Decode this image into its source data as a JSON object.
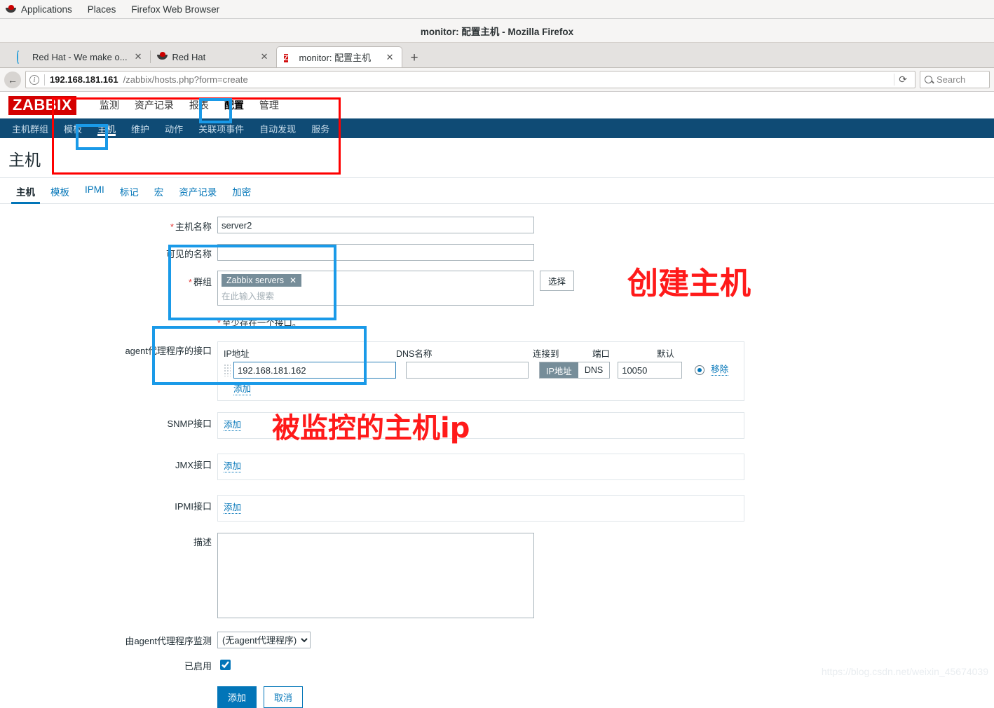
{
  "desktop": {
    "menus": [
      "Applications",
      "Places",
      "Firefox Web Browser"
    ],
    "logo_icon": "redhat-icon"
  },
  "browser": {
    "window_title": "monitor: 配置主机 - Mozilla Firefox",
    "tabs": [
      {
        "title": "Red Hat - We make o...",
        "icon": "ring-icon",
        "active": false,
        "close": "✕"
      },
      {
        "title": "Red Hat",
        "icon": "redhat-icon",
        "active": false,
        "close": "✕"
      },
      {
        "title": "monitor: 配置主机",
        "icon": "zabbix-icon",
        "active": true,
        "close": "✕"
      }
    ],
    "new_tab_label": "+",
    "back_icon": "back-arrow-icon",
    "url_host": "192.168.181.161",
    "url_path": "/zabbix/hosts.php?form=create",
    "reload_icon": "reload-icon",
    "search_placeholder": "Search",
    "search_icon": "search-icon"
  },
  "zabbix": {
    "logo": "ZABBIX",
    "main_menu": [
      {
        "label": "监测",
        "selected": false
      },
      {
        "label": "资产记录",
        "selected": false
      },
      {
        "label": "报表",
        "selected": false
      },
      {
        "label": "配置",
        "selected": true
      },
      {
        "label": "管理",
        "selected": false
      }
    ],
    "sub_menu": [
      {
        "label": "主机群组",
        "selected": false
      },
      {
        "label": "模板",
        "selected": false
      },
      {
        "label": "主机",
        "selected": true
      },
      {
        "label": "维护",
        "selected": false
      },
      {
        "label": "动作",
        "selected": false
      },
      {
        "label": "关联项事件",
        "selected": false
      },
      {
        "label": "自动发现",
        "selected": false
      },
      {
        "label": "服务",
        "selected": false
      }
    ],
    "page_title": "主机",
    "form_tabs": [
      {
        "label": "主机",
        "selected": true
      },
      {
        "label": "模板",
        "selected": false
      },
      {
        "label": "IPMI",
        "selected": false
      },
      {
        "label": "标记",
        "selected": false
      },
      {
        "label": "宏",
        "selected": false
      },
      {
        "label": "资产记录",
        "selected": false
      },
      {
        "label": "加密",
        "selected": false
      }
    ],
    "form": {
      "hostname_label": "主机名称",
      "hostname_value": "server2",
      "visiblename_label": "可见的名称",
      "visiblename_value": "",
      "group_label": "群组",
      "group_chip": "Zabbix servers",
      "group_chip_remove": "✕",
      "group_placeholder": "在此输入搜索",
      "select_button": "选择",
      "interface_hint": "至少存在一个接口。",
      "agent_interface_label": "agent代理程序的接口",
      "col_ip": "IP地址",
      "col_dns": "DNS名称",
      "col_connect": "连接到",
      "col_port": "端口",
      "col_default": "默认",
      "ip_value": "192.168.181.162",
      "dns_value": "",
      "connect_ip_label": "IP地址",
      "connect_dns_label": "DNS",
      "connect_selected": "IP地址",
      "port_value": "10050",
      "remove_label": "移除",
      "add_label": "添加",
      "snmp_label": "SNMP接口",
      "jmx_label": "JMX接口",
      "ipmi_label": "IPMI接口",
      "description_label": "描述",
      "description_value": "",
      "proxy_label": "由agent代理程序监测",
      "proxy_value": "(无agent代理程序)",
      "proxy_options": [
        "(无agent代理程序)"
      ],
      "enabled_label": "已启用",
      "enabled_checked": true,
      "submit_label": "添加",
      "cancel_label": "取消"
    }
  },
  "annotations": {
    "create_host_text": "创建主机",
    "monitored_ip_text": "被监控的主机ip",
    "red_color": "#fe0000",
    "blue_color": "#1a9ae8"
  },
  "watermark": "https://blog.csdn.net/weixin_45674039"
}
